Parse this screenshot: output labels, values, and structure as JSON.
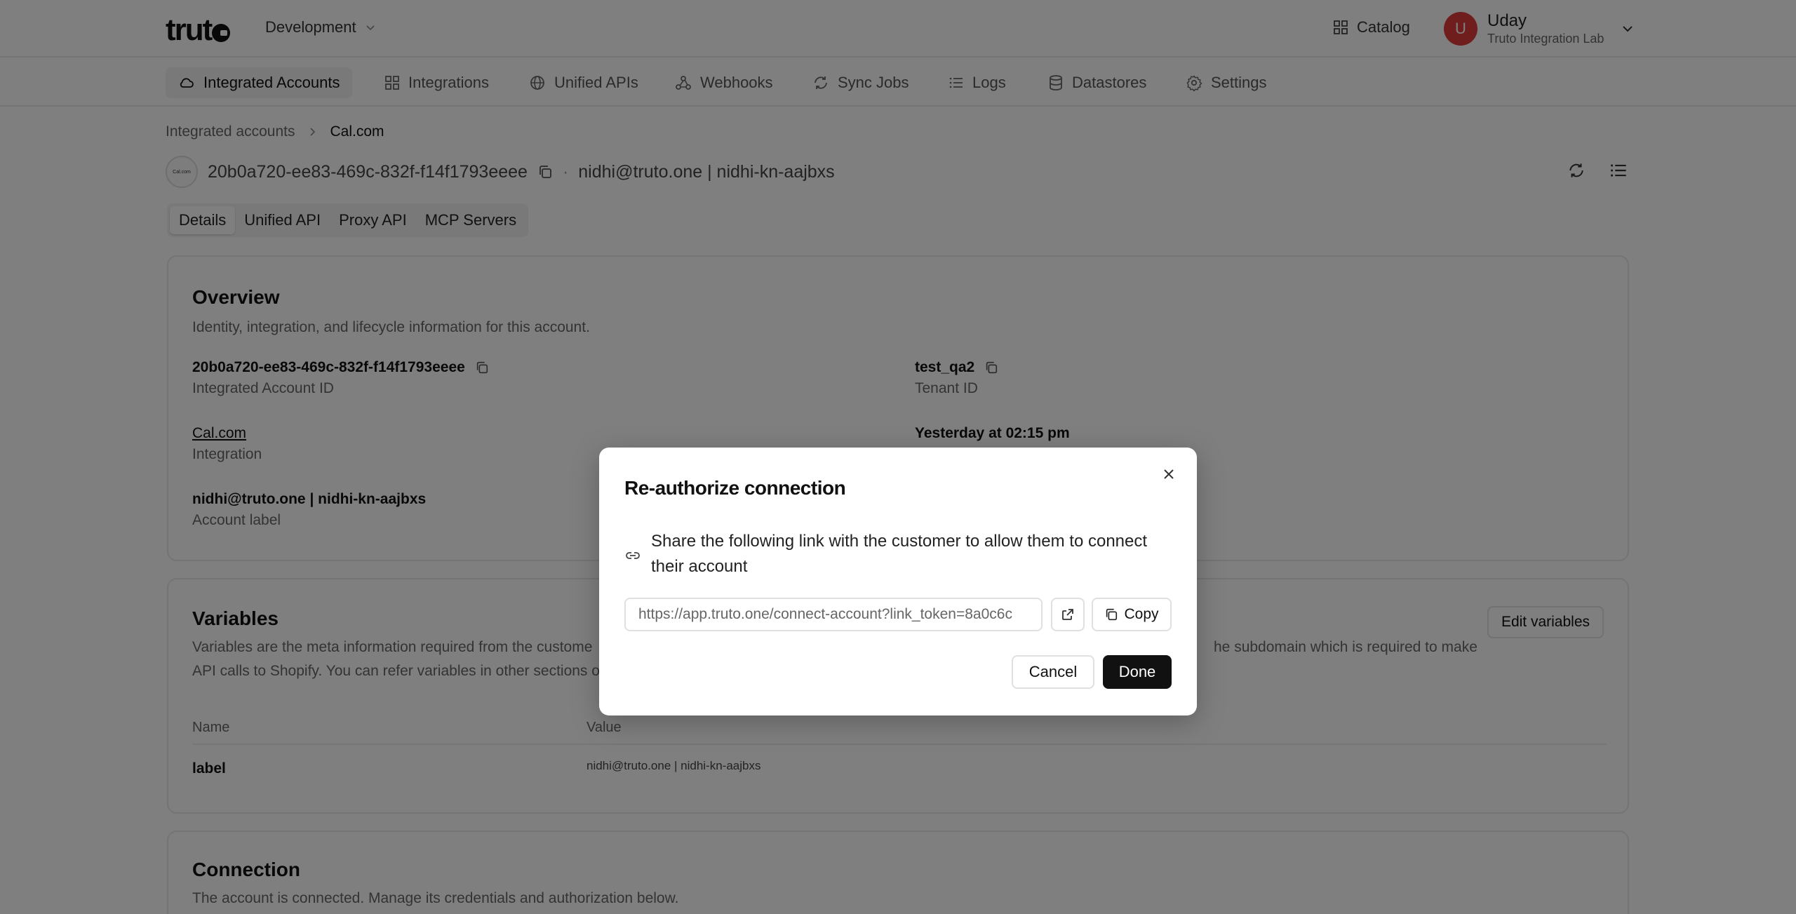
{
  "topbar": {
    "logo_text": "truto",
    "environment": "Development",
    "catalog_label": "Catalog",
    "user_initial": "U",
    "user_name": "Uday",
    "user_org": "Truto Integration Lab"
  },
  "nav": {
    "items": [
      {
        "label": "Integrated Accounts",
        "icon": "cloud-icon",
        "active": true
      },
      {
        "label": "Integrations",
        "icon": "grid-icon"
      },
      {
        "label": "Unified APIs",
        "icon": "globe-icon"
      },
      {
        "label": "Webhooks",
        "icon": "webhook-icon"
      },
      {
        "label": "Sync Jobs",
        "icon": "sync-icon"
      },
      {
        "label": "Logs",
        "icon": "list-icon"
      },
      {
        "label": "Datastores",
        "icon": "database-icon"
      },
      {
        "label": "Settings",
        "icon": "gear-icon"
      }
    ]
  },
  "breadcrumb": {
    "parent": "Integrated accounts",
    "current": "Cal.com"
  },
  "account": {
    "logo_text": "Cal.com",
    "id": "20b0a720-ee83-469c-832f-f14f1793eeee",
    "separator": "·",
    "label": "nidhi@truto.one | nidhi-kn-aajbxs"
  },
  "tabs": [
    "Details",
    "Unified API",
    "Proxy API",
    "MCP Servers"
  ],
  "overview": {
    "title": "Overview",
    "description": "Identity, integration, and lifecycle information for this account.",
    "fields": {
      "account_id_value": "20b0a720-ee83-469c-832f-f14f1793eeee",
      "account_id_label": "Integrated Account ID",
      "tenant_value": "test_qa2",
      "tenant_label": "Tenant ID",
      "integration_value": "Cal.com",
      "integration_label": "Integration",
      "updated_value": "Yesterday at 02:15 pm",
      "label_value": "nidhi@truto.one | nidhi-kn-aajbxs",
      "label_label": "Account label"
    }
  },
  "variables": {
    "title": "Variables",
    "description_left": "Variables are the meta information required from the custome",
    "description_right": "he subdomain which is required to make",
    "description_line2": "API calls to Shopify. You can refer variables in other sections o",
    "edit_label": "Edit variables",
    "columns": [
      "Name",
      "Value"
    ],
    "rows": [
      {
        "name": "label",
        "value": "nidhi@truto.one | nidhi-kn-aajbxs"
      }
    ]
  },
  "connection": {
    "title": "Connection",
    "description": "The account is connected. Manage its credentials and authorization below."
  },
  "modal": {
    "title": "Re-authorize connection",
    "message": "Share the following link with the customer to allow them to connect their account",
    "url": "https://app.truto.one/connect-account?link_token=8a0c6c",
    "copy_label": "Copy",
    "cancel_label": "Cancel",
    "done_label": "Done"
  },
  "colors": {
    "avatar": "#e03a3a",
    "primary_button": "#111111",
    "overlay": "rgba(0,0,0,0.5)"
  }
}
